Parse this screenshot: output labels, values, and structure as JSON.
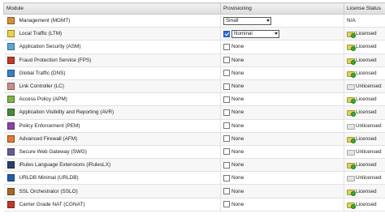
{
  "headers": {
    "module": "Module",
    "provisioning": "Provisioning",
    "license_status": "License Status"
  },
  "colors": {
    "checked": "#2f6fd6",
    "licensed_badge": "#36a836"
  },
  "rows": [
    {
      "name": "Management (MGMT)",
      "icon_color": "#d38f3b",
      "prov_type": "select",
      "prov_value": "Small",
      "checked": false,
      "license": "N/A",
      "license_icon": ""
    },
    {
      "name": "Local Traffic (LTM)",
      "icon_color": "#e7d24a",
      "prov_type": "checkbox-select",
      "prov_value": "Nominal",
      "checked": true,
      "license": "Licensed",
      "license_icon": "licensed-key-icon"
    },
    {
      "name": "Application Security (ASM)",
      "icon_color": "#5aa6d6",
      "prov_type": "checkbox",
      "prov_value": "None",
      "checked": false,
      "license": "Licensed",
      "license_icon": "licensed-key-icon"
    },
    {
      "name": "Fraud Protection Service (FPS)",
      "icon_color": "#c0392b",
      "prov_type": "checkbox",
      "prov_value": "None",
      "checked": false,
      "license": "Licensed",
      "license_icon": "licensed-key-icon"
    },
    {
      "name": "Global Traffic (DNS)",
      "icon_color": "#3a7fc1",
      "prov_type": "checkbox",
      "prov_value": "None",
      "checked": false,
      "license": "Licensed",
      "license_icon": "licensed-key-icon"
    },
    {
      "name": "Link Controller (LC)",
      "icon_color": "#d08a8a",
      "prov_type": "checkbox",
      "prov_value": "None",
      "checked": false,
      "license": "Unlicensed",
      "license_icon": "unlicensed-key-icon"
    },
    {
      "name": "Access Policy (APM)",
      "icon_color": "#7fb34a",
      "prov_type": "checkbox",
      "prov_value": "None",
      "checked": false,
      "license": "Licensed",
      "license_icon": "licensed-key-icon"
    },
    {
      "name": "Application Visibility and Reporting (AVR)",
      "icon_color": "#4a8a3a",
      "prov_type": "checkbox",
      "prov_value": "None",
      "checked": false,
      "license": "Licensed",
      "license_icon": "licensed-key-icon"
    },
    {
      "name": "Policy Enforcement (PEM)",
      "icon_color": "#8e44ad",
      "prov_type": "checkbox",
      "prov_value": "None",
      "checked": false,
      "license": "Unlicensed",
      "license_icon": "unlicensed-key-icon"
    },
    {
      "name": "Advanced Firewall (AFM)",
      "icon_color": "#e07a2e",
      "prov_type": "checkbox",
      "prov_value": "None",
      "checked": false,
      "license": "Licensed",
      "license_icon": "licensed-key-icon"
    },
    {
      "name": "Secure Web Gateway (SWG)",
      "icon_color": "#6b5b95",
      "prov_type": "checkbox",
      "prov_value": "None",
      "checked": false,
      "license": "Unlicensed",
      "license_icon": "unlicensed-key-icon"
    },
    {
      "name": "iRules Language Extensions (iRulesLX)",
      "icon_color": "#2c3e6b",
      "prov_type": "checkbox",
      "prov_value": "None",
      "checked": false,
      "license": "Licensed",
      "license_icon": "licensed-key-icon"
    },
    {
      "name": "URLDB Minimal (URLDB)",
      "icon_color": "#1f5fa8",
      "prov_type": "checkbox",
      "prov_value": "None",
      "checked": false,
      "license": "Unlicensed",
      "license_icon": "unlicensed-key-icon"
    },
    {
      "name": "SSL Orchestrator (SSLO)",
      "icon_color": "#a56a2a",
      "prov_type": "checkbox",
      "prov_value": "None",
      "checked": false,
      "license": "Licensed",
      "license_icon": "licensed-key-icon"
    },
    {
      "name": "Carrier Grade NAT (CGNAT)",
      "icon_color": "#c0392b",
      "prov_type": "checkbox",
      "prov_value": "None",
      "checked": false,
      "license": "Licensed",
      "license_icon": "licensed-key-icon"
    }
  ]
}
